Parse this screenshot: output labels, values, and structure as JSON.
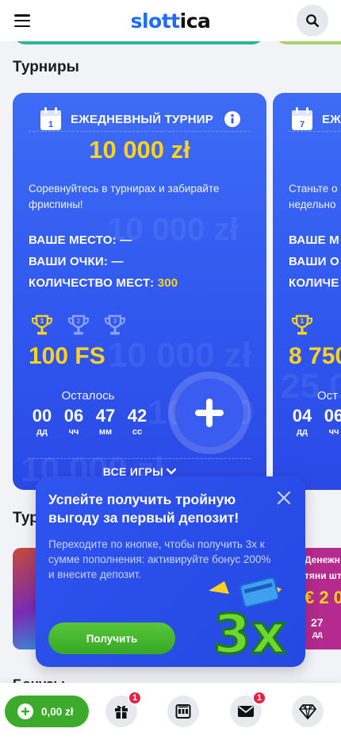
{
  "header": {
    "logo_part1": "slott",
    "logo_part2": "ica"
  },
  "tournaments": {
    "section_title": "Турниры",
    "cards": [
      {
        "calendar_day": "1",
        "title": "ЕЖЕДНЕВНЫЙ ТУРНИР",
        "prize": "10 000 zł",
        "watermark": "10 000 zł",
        "description": "Соревнуйтесь в турнирах и забирайте фриспины!",
        "place_label": "ВАШЕ МЕСТО: —",
        "points_label": "ВАШИ ОЧКИ: —",
        "seats_label": "КОЛИЧЕСТВО МЕСТ:",
        "seats_value": "300",
        "first_prize": "100 FS",
        "remaining_label": "Осталось",
        "timer": [
          {
            "num": "00",
            "lbl": "дд"
          },
          {
            "num": "06",
            "lbl": "чч"
          },
          {
            "num": "47",
            "lbl": "мм"
          },
          {
            "num": "42",
            "lbl": "сс"
          }
        ],
        "all_games": "ВСЕ ИГРЫ"
      },
      {
        "calendar_day": "7",
        "title": "ЕЖЕ",
        "description_line1": "Станьте о",
        "description_line2": "недельно",
        "place_label": "ВАШЕ М",
        "points_label": "ВАШИ О",
        "seats_label": "КОЛИЧЕ",
        "first_prize": "8 750",
        "watermark": "25 0",
        "remaining_label": "Ост",
        "timer": [
          {
            "num": "04",
            "lbl": "дд"
          },
          {
            "num": "06",
            "lbl": "чч"
          }
        ]
      }
    ]
  },
  "second_section": {
    "title_peek": "Тур",
    "right_peek": {
      "line1": "Денежн",
      "line2": "тяни шт",
      "amount": "€ 2 0",
      "timer_num": "27",
      "timer_lbl": "дд"
    }
  },
  "popup": {
    "title": "Успейте получить тройную выгоду за первый депозит!",
    "text": "Переходите по кнопке, чтобы получить 3x к сумме пополнения: активируйте бонус 200% и внесите депозит.",
    "button": "Получить",
    "art_label": "3x"
  },
  "bonus_peek": "Бонусы",
  "bottom_nav": {
    "balance": "0,00 zł",
    "gift_badge": "1",
    "mail_badge": "1"
  },
  "colors": {
    "brand_blue": "#1f6bff",
    "card_blue": "#2f56ee",
    "prize_yellow": "#ffd21f",
    "green": "#3caa2b",
    "badge_red": "#e62143"
  }
}
